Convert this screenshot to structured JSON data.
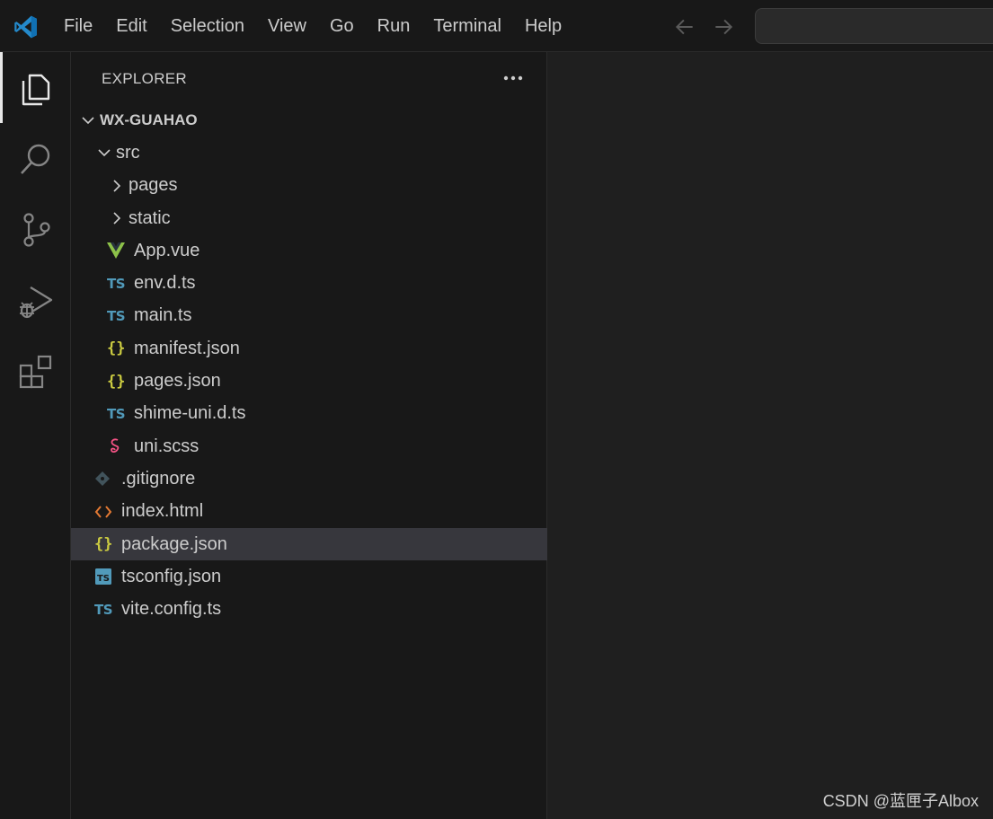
{
  "menu": [
    "File",
    "Edit",
    "Selection",
    "View",
    "Go",
    "Run",
    "Terminal",
    "Help"
  ],
  "sidebar": {
    "title": "EXPLORER",
    "root": "WX-GUAHAO",
    "tree": [
      {
        "label": "src",
        "indent": 1,
        "chevron": "down",
        "icon": "none"
      },
      {
        "label": "pages",
        "indent": 2,
        "chevron": "right",
        "icon": "none"
      },
      {
        "label": "static",
        "indent": 2,
        "chevron": "right",
        "icon": "none"
      },
      {
        "label": "App.vue",
        "indent": 2,
        "chevron": "none",
        "icon": "vue"
      },
      {
        "label": "env.d.ts",
        "indent": 2,
        "chevron": "none",
        "icon": "ts"
      },
      {
        "label": "main.ts",
        "indent": 2,
        "chevron": "none",
        "icon": "ts"
      },
      {
        "label": "manifest.json",
        "indent": 2,
        "chevron": "none",
        "icon": "json"
      },
      {
        "label": "pages.json",
        "indent": 2,
        "chevron": "none",
        "icon": "json"
      },
      {
        "label": "shime-uni.d.ts",
        "indent": 2,
        "chevron": "none",
        "icon": "ts"
      },
      {
        "label": "uni.scss",
        "indent": 2,
        "chevron": "none",
        "icon": "sass"
      },
      {
        "label": ".gitignore",
        "indent": 1,
        "chevron": "none",
        "icon": "git"
      },
      {
        "label": "index.html",
        "indent": 1,
        "chevron": "none",
        "icon": "html"
      },
      {
        "label": "package.json",
        "indent": 1,
        "chevron": "none",
        "icon": "json",
        "selected": true
      },
      {
        "label": "tsconfig.json",
        "indent": 1,
        "chevron": "none",
        "icon": "tsconfig"
      },
      {
        "label": "vite.config.ts",
        "indent": 1,
        "chevron": "none",
        "icon": "ts"
      }
    ]
  },
  "icons": {
    "ts_text": "TS",
    "json_text": "{}",
    "ts_color": "#519aba",
    "json_color": "#cbcb41",
    "vue_color": "#8dc149",
    "sass_color": "#f55385",
    "html_color": "#e37933",
    "git_color": "#41535b"
  },
  "activity_bar": [
    "explorer-icon",
    "search-icon",
    "source-control-icon",
    "run-debug-icon",
    "extensions-icon"
  ],
  "watermark": "CSDN @蓝匣子Albox"
}
